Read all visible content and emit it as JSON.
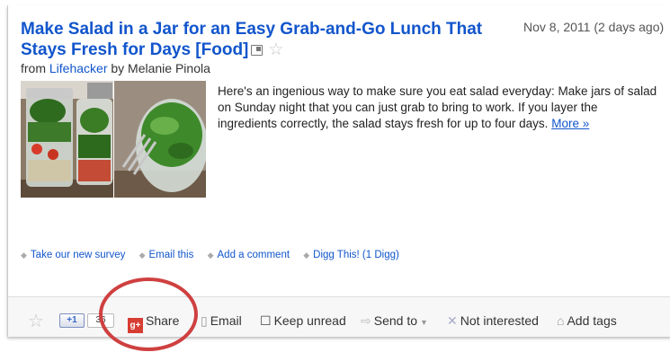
{
  "item": {
    "title": "Make Salad in a Jar for an Easy Grab-and-Go Lunch That Stays Fresh for Days [Food]",
    "date": "Nov 8, 2011 (2 days ago)",
    "source_prefix": "from",
    "source_name": "Lifehacker",
    "source_by": "by Melanie Pinola",
    "snippet": "Here's an ingenious way to make sure you eat salad everyday: Make jars of salad on Sunday night that you can just grab to bring to work. If you layer the ingredients correctly, the salad stays fresh for up to four days.",
    "more_label": "More »"
  },
  "inline_actions": [
    "Take our new survey",
    "Email this",
    "Add a comment",
    "Digg This! (1 Digg)"
  ],
  "footer": {
    "plusone_label": "+1",
    "plusone_count": "36",
    "share_label": "Share",
    "share_icon_text": "g+",
    "email_label": "Email",
    "keep_unread_label": "Keep unread",
    "send_to_label": "Send to",
    "not_interested_label": "Not interested",
    "add_tags_label": "Add tags"
  },
  "icons": {
    "star": "star-icon",
    "popout": "popout-icon",
    "share": "google-plus-icon"
  },
  "colors": {
    "link": "#1155cc",
    "highlight_ring": "#cf4040",
    "share_icon": "#d73d32"
  }
}
